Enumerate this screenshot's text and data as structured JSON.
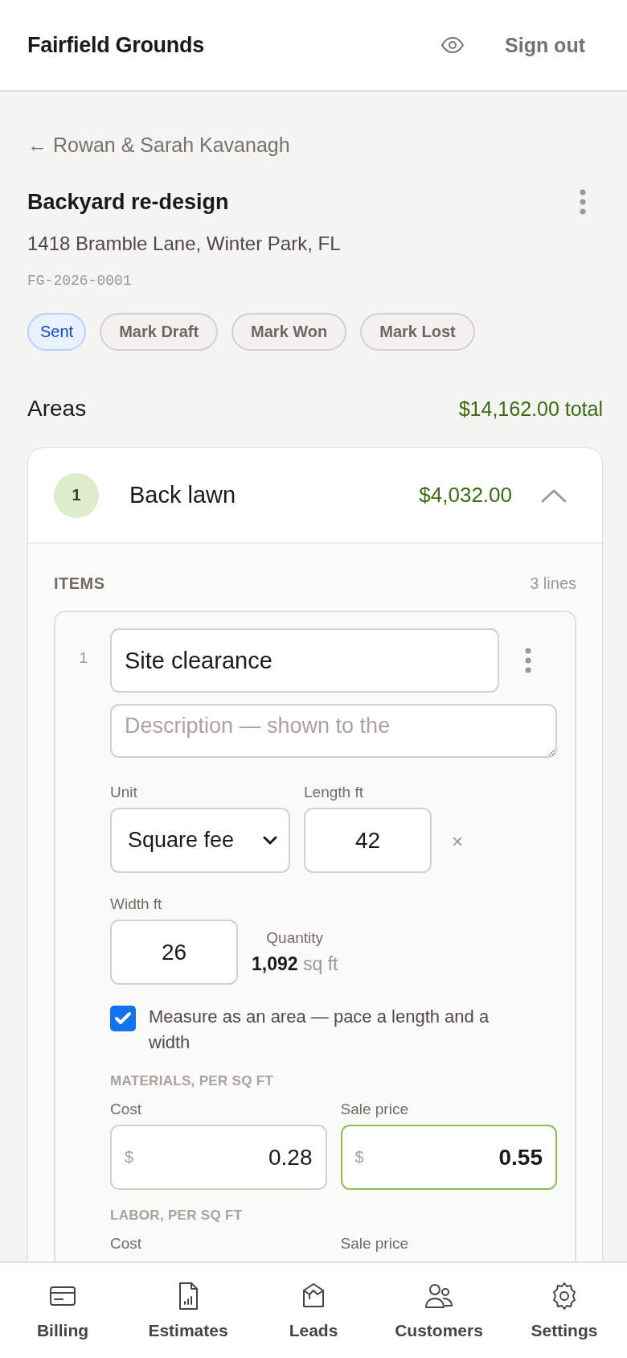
{
  "header": {
    "brand": "Fairfield Grounds",
    "sign_out": "Sign out"
  },
  "back_link": "← Rowan & Sarah Kavanagh",
  "estimate": {
    "title": "Backyard re-design",
    "address": "1418 Bramble Lane, Winter Park, FL",
    "code": "FG-2026-0001",
    "statuses": [
      {
        "label": "Sent",
        "selected": true
      },
      {
        "label": "Mark Draft",
        "selected": false
      },
      {
        "label": "Mark Won",
        "selected": false
      },
      {
        "label": "Mark Lost",
        "selected": false
      }
    ]
  },
  "areas": {
    "title": "Areas",
    "total": "$14,162.00 total",
    "list": [
      {
        "number": "1",
        "name": "Back lawn",
        "amount": "$4,032.00",
        "expanded": true,
        "items_label": "ITEMS",
        "line_count": "3 lines",
        "items": [
          {
            "number": "1",
            "name": "Site clearance",
            "description": {
              "placeholder": "Description — shown to the"
            },
            "unit": {
              "label": "Unit",
              "value": "Square fee"
            },
            "length": {
              "label": "Length ft",
              "value": "42"
            },
            "times": "×",
            "width": {
              "label": "Width ft",
              "value": "26"
            },
            "quantity": {
              "label": "Quantity",
              "value": "1,092",
              "unit": "sq ft"
            },
            "area_toggle": {
              "label": "Measure as an area — pace a length and a width",
              "checked": true
            },
            "pricing": [
              {
                "title": "MATERIALS, PER SQ FT",
                "fields": [
                  {
                    "label": "Cost",
                    "currency": "$",
                    "value": "0.28",
                    "focused": false
                  },
                  {
                    "label": "Sale price",
                    "currency": "$",
                    "value": "0.55",
                    "focused": true
                  }
                ]
              },
              {
                "title": "LABOR, PER SQ FT",
                "fields": [
                  {
                    "label": "Cost"
                  },
                  {
                    "label": "Sale price"
                  }
                ]
              }
            ]
          }
        ]
      }
    ]
  },
  "nav": [
    {
      "label": "Billing",
      "selected": false
    },
    {
      "label": "Estimates",
      "selected": false
    },
    {
      "label": "Leads",
      "selected": false
    },
    {
      "label": "Customers",
      "selected": false
    },
    {
      "label": "Settings",
      "selected": false
    }
  ]
}
